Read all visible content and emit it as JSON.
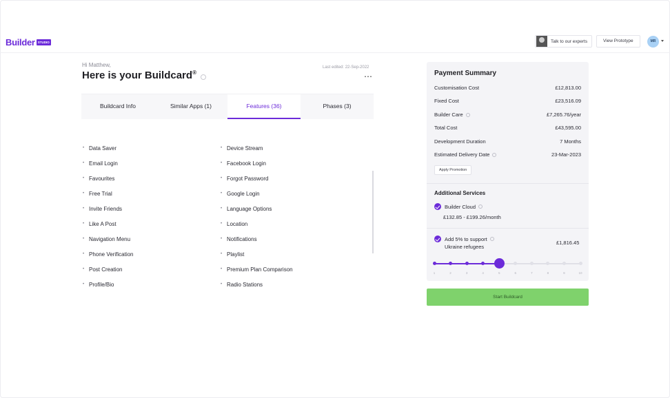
{
  "header": {
    "logo_text": "Builder",
    "logo_badge": "STUDIO",
    "expert_button": "Talk to our experts",
    "prototype_button": "View Prototype",
    "user_initials": "MR"
  },
  "buildcard": {
    "greeting": "Hi Matthew,",
    "title": "Here is your Buildcard",
    "registered": "®",
    "last_edited": "Last edited: 22-Sep-2022",
    "more_icon": "⋯",
    "tabs": [
      {
        "label": "Buildcard Info",
        "active": false
      },
      {
        "label": "Similar Apps (1)",
        "active": false
      },
      {
        "label": "Features (36)",
        "active": true
      },
      {
        "label": "Phases (3)",
        "active": false
      }
    ],
    "features_col1": [
      "Data Saver",
      "Email Login",
      "Favourites",
      "Free Trial",
      "Invite Friends",
      "Like A Post",
      "Navigation Menu",
      "Phone Verification",
      "Post Creation",
      "Profile/Bio"
    ],
    "features_col2": [
      "Device Stream",
      "Facebook Login",
      "Forgot Password",
      "Google Login",
      "Language Options",
      "Location",
      "Notifications",
      "Playlist",
      "Premium Plan Comparison",
      "Radio Stations"
    ],
    "bullet": "•"
  },
  "payment_summary": {
    "title": "Payment Summary",
    "rows": [
      {
        "label": "Customisation Cost",
        "value": "£12,813.00",
        "info": false
      },
      {
        "label": "Fixed Cost",
        "value": "£23,516.09",
        "info": false
      },
      {
        "label": "Builder Care",
        "value": "£7,265.76/year",
        "info": true
      },
      {
        "label": "Total Cost",
        "value": "£43,595.00",
        "info": false
      },
      {
        "label": "Development Duration",
        "value": "7 Months",
        "info": false
      },
      {
        "label": "Estimated Delivery Date",
        "value": "23-Mar-2023",
        "info": true
      }
    ],
    "promo_button": "Apply Promotion",
    "additional_title": "Additional Services",
    "builder_cloud_label": "Builder Cloud",
    "builder_cloud_price": "£132.85 - £199.26/month",
    "support_label": "Add 5% to support",
    "support_sub": "Ukraine refugees",
    "support_price": "£1,816.45",
    "slider_value": 5,
    "slider_labels": [
      "1",
      "2",
      "3",
      "4",
      "5",
      "6",
      "7",
      "8",
      "9",
      "10"
    ],
    "start_button": "Start Buildcard"
  },
  "colors": {
    "accent": "#6c2bd9",
    "start_button": "#7fd26c"
  }
}
